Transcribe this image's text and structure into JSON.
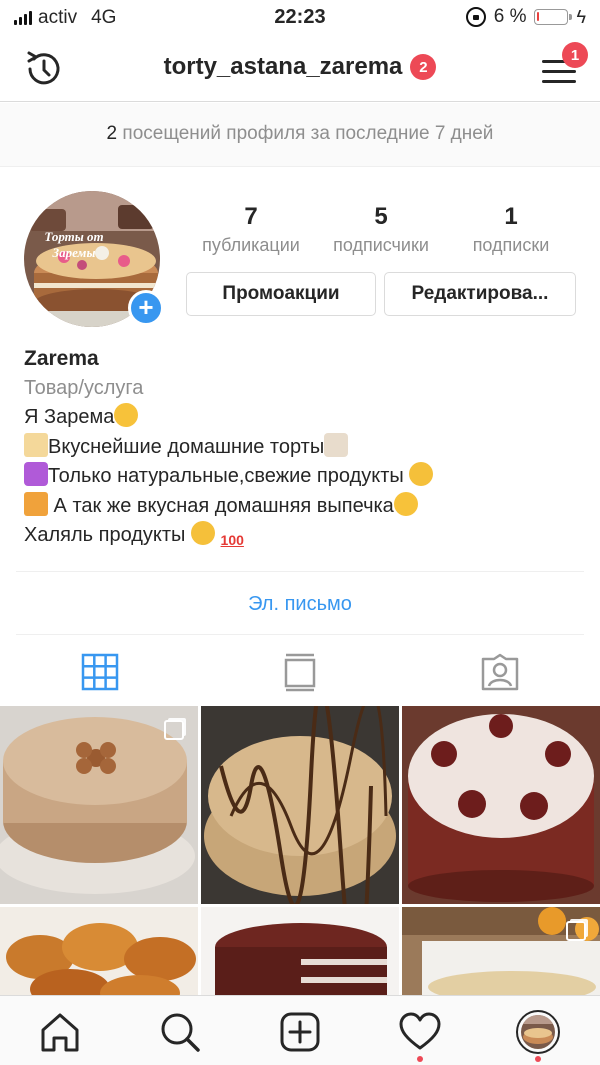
{
  "status_bar": {
    "carrier": "activ",
    "network": "4G",
    "time": "22:23",
    "battery": "6 %",
    "battery_level": 0.06
  },
  "header": {
    "username": "torty_astana_zarema",
    "account_badge": "2",
    "menu_badge": "1"
  },
  "visits": {
    "count": "2",
    "text": " посещений профиля за последние 7 дней"
  },
  "profile": {
    "avatar_text_line1": "Торты от",
    "avatar_text_line2": "Заремы",
    "stats": [
      {
        "value": "7",
        "label": "публикации"
      },
      {
        "value": "5",
        "label": "подписчики"
      },
      {
        "value": "1",
        "label": "подписки"
      }
    ],
    "promo_button": "Промоакции",
    "edit_button": "Редактирова..."
  },
  "bio": {
    "name": "Zarema",
    "category": "Товар/услуга",
    "lines": [
      "Я Зарема",
      "Вкуснейшие домашние торты",
      "Только натуральные,свежие продукты ",
      " А так же вкусная домашняя выпечка",
      "Халяль продукты "
    ],
    "email_label": "Эл. письмо"
  },
  "colors": {
    "accent": "#3897f0",
    "badge": "#ed4956",
    "text": "#262626",
    "muted": "#8e8e8e"
  },
  "icons": {
    "header_left": "history-icon",
    "header_right": "hamburger-menu-icon",
    "tabs": [
      "grid-icon",
      "feed-icon",
      "tagged-icon"
    ],
    "bottom_nav": [
      "home-icon",
      "search-icon",
      "add-post-icon",
      "heart-icon",
      "profile-icon"
    ]
  }
}
